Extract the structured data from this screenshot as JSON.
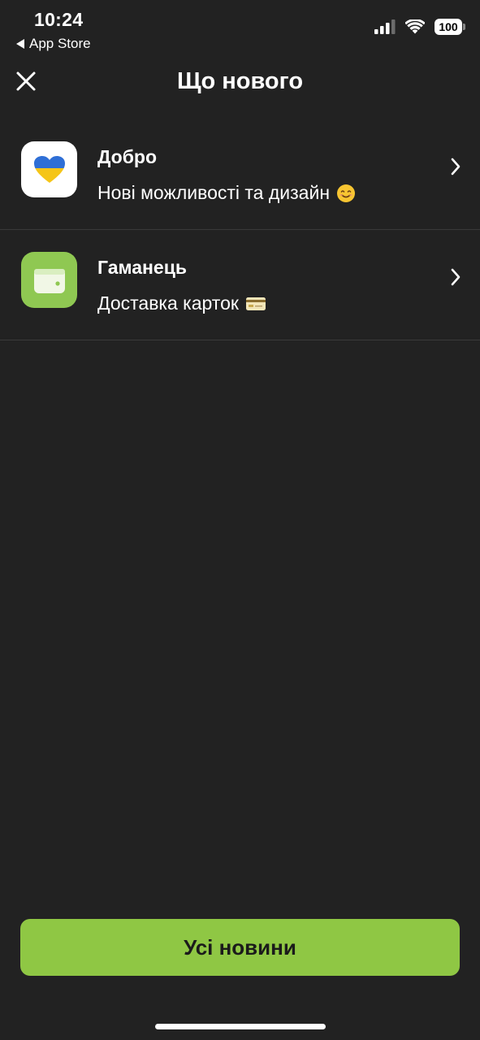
{
  "status_bar": {
    "time": "10:24",
    "back_app_label": "App Store",
    "battery_level": "100"
  },
  "header": {
    "title": "Що нового",
    "close_icon": "close-icon"
  },
  "news": [
    {
      "title": "Добро",
      "subtitle": "Нові можливості та дизайн",
      "icon": "ukraine-heart-icon",
      "subtitle_emoji": "smiling-face-icon"
    },
    {
      "title": "Гаманець",
      "subtitle": "Доставка карток",
      "icon": "wallet-icon",
      "subtitle_emoji": "credit-card-icon"
    }
  ],
  "footer": {
    "all_news_label": "Усі новини"
  },
  "colors": {
    "background": "#222222",
    "accent_green": "#8fc744",
    "wallet_icon_bg": "#8fc852",
    "divider": "#3a3a3a"
  }
}
